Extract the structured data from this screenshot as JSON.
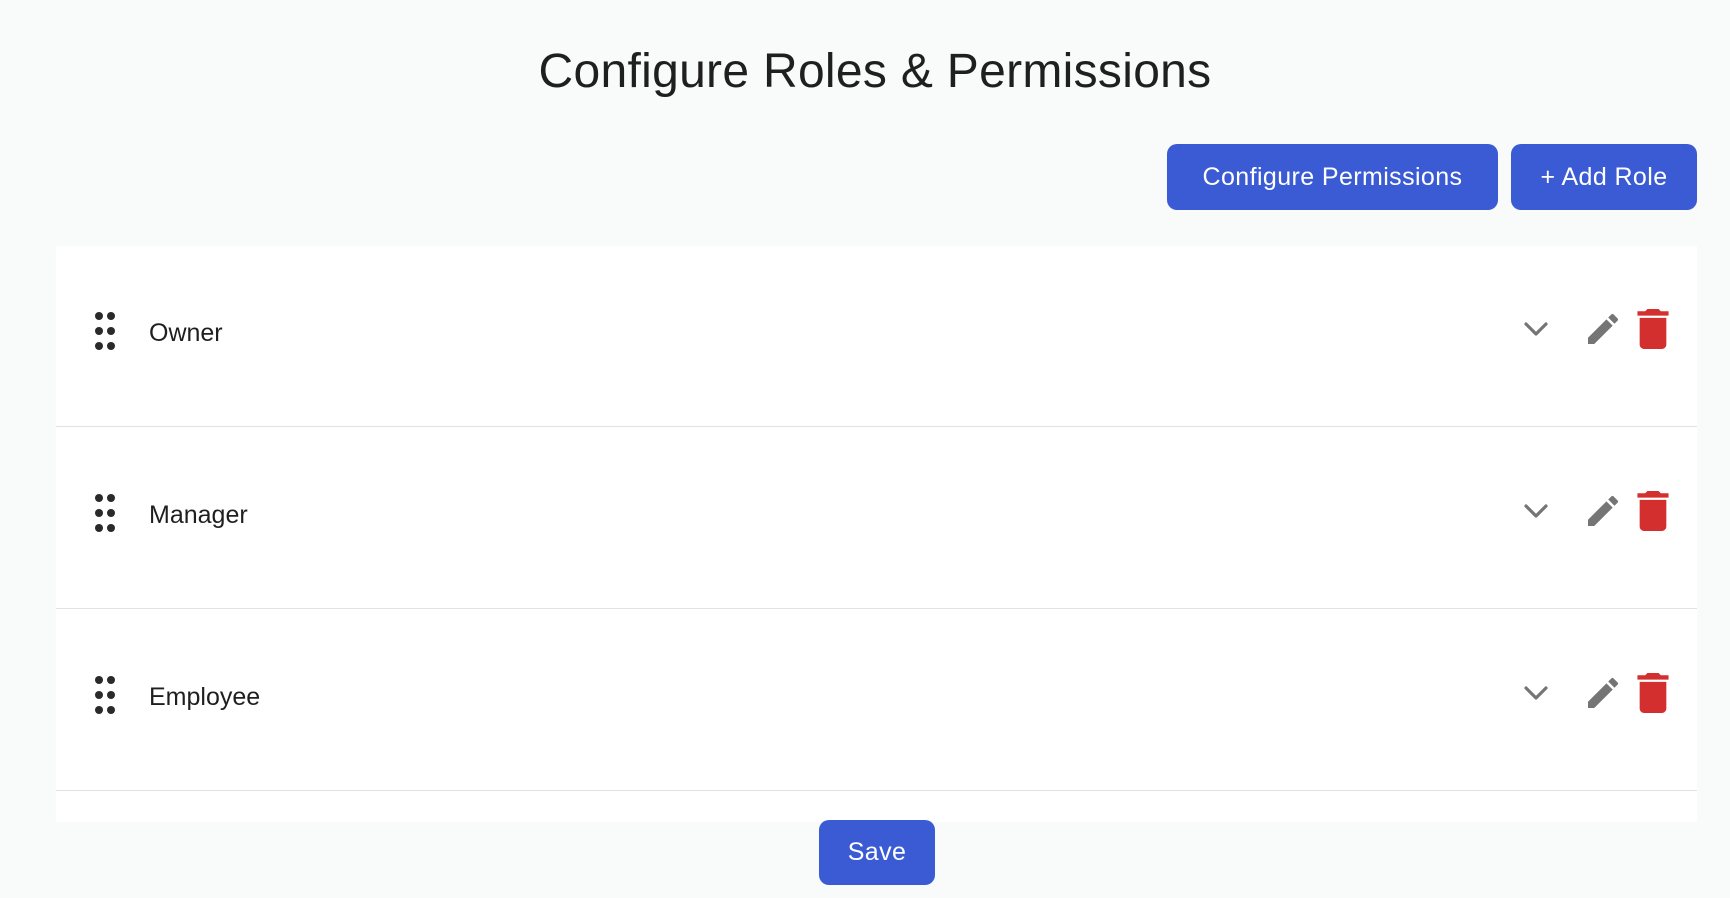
{
  "page": {
    "title": "Configure Roles & Permissions"
  },
  "toolbar": {
    "configure_permissions_label": "Configure Permissions",
    "add_role_label": "+ Add Role"
  },
  "roles": [
    {
      "name": "Owner"
    },
    {
      "name": "Manager"
    },
    {
      "name": "Employee"
    }
  ],
  "footer": {
    "save_label": "Save"
  },
  "icons": {
    "drag": "drag-handle-icon",
    "expand": "chevron-down-icon",
    "edit": "pencil-icon",
    "delete": "trash-icon"
  },
  "colors": {
    "primary": "#3b5bd4",
    "danger": "#d32f2f",
    "icon_gray": "#757575",
    "background": "#f9fafa"
  }
}
